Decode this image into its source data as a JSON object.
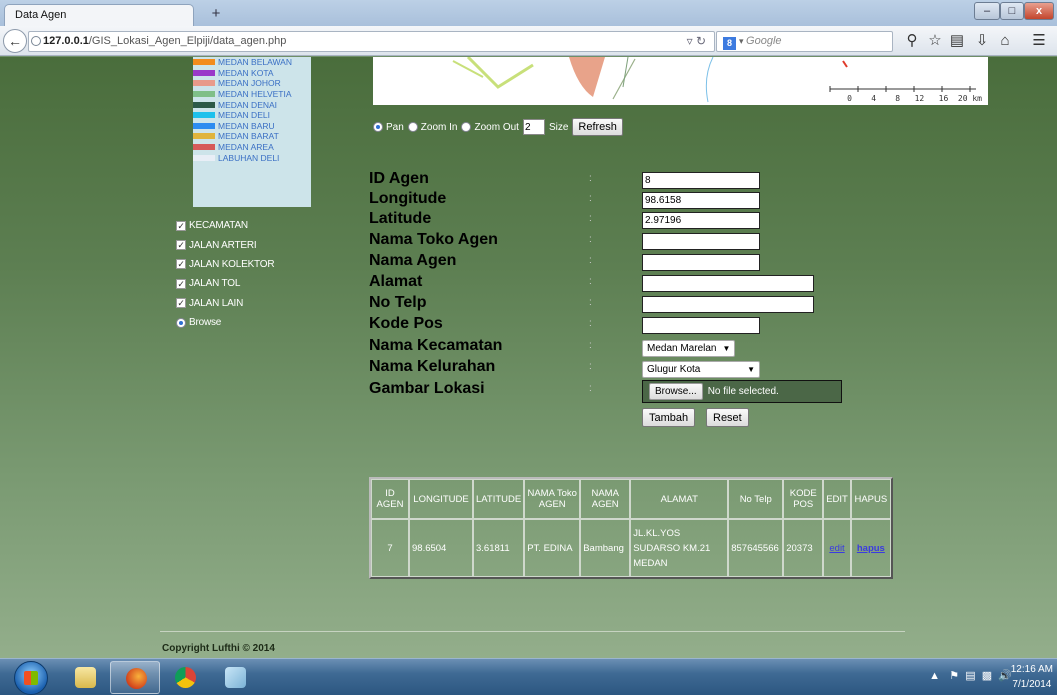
{
  "browser": {
    "tab_title": "Data Agen",
    "new_tab": "+",
    "url_host": "127.0.0.1",
    "url_path": "/GIS_Lokasi_Agen_Elpiji/data_agen.php",
    "search_placeholder": "Google",
    "search_engine_icon": "8",
    "win_min": "–",
    "win_max": "□",
    "win_close": "x"
  },
  "legend": {
    "items": [
      {
        "label": "MEDAN BELAWAN",
        "color": "#f28c1d"
      },
      {
        "label": "MEDAN KOTA",
        "color": "#9a39c9"
      },
      {
        "label": "MEDAN JOHOR",
        "color": "#e89a8a"
      },
      {
        "label": "MEDAN HELVETIA",
        "color": "#7fbf88"
      },
      {
        "label": "MEDAN DENAI",
        "color": "#2c5a48"
      },
      {
        "label": "MEDAN DELI",
        "color": "#1ec1ec"
      },
      {
        "label": "MEDAN BARU",
        "color": "#2d8cf0"
      },
      {
        "label": "MEDAN BARAT",
        "color": "#e0b43c"
      },
      {
        "label": "MEDAN AREA",
        "color": "#d65a5a"
      },
      {
        "label": "LABUHAN DELI",
        "color": "#e8eef6"
      }
    ]
  },
  "layers": {
    "items": [
      {
        "label": "KECAMATAN",
        "type": "checkbox"
      },
      {
        "label": "JALAN ARTERI",
        "type": "checkbox"
      },
      {
        "label": "JALAN KOLEKTOR",
        "type": "checkbox"
      },
      {
        "label": "JALAN TOL",
        "type": "checkbox"
      },
      {
        "label": "JALAN LAIN",
        "type": "checkbox"
      },
      {
        "label": "Browse",
        "type": "radio"
      }
    ]
  },
  "map": {
    "scale_ticks": "0    4    8   12   16  20 km"
  },
  "map_tools": {
    "pan": "Pan",
    "zoom_in": "Zoom In",
    "zoom_out": "Zoom Out",
    "zoom_value": "2",
    "size": "Size",
    "refresh": "Refresh"
  },
  "form": {
    "colon": ":",
    "id_agen": {
      "label": "ID Agen",
      "value": "8"
    },
    "longitude": {
      "label": "Longitude",
      "value": "98.6158"
    },
    "latitude": {
      "label": "Latitude",
      "value": "2.97196"
    },
    "nama_toko": {
      "label": "Nama Toko Agen",
      "value": ""
    },
    "nama_agen": {
      "label": "Nama Agen",
      "value": ""
    },
    "alamat": {
      "label": "Alamat",
      "value": ""
    },
    "no_telp": {
      "label": "No Telp",
      "value": ""
    },
    "kode_pos": {
      "label": "Kode Pos",
      "value": ""
    },
    "kecamatan": {
      "label": "Nama Kecamatan",
      "value": "Medan Marelan"
    },
    "kelurahan": {
      "label": "Nama Kelurahan",
      "value": "Glugur Kota"
    },
    "gambar": {
      "label": "Gambar Lokasi",
      "browse": "Browse...",
      "status": "No file selected."
    },
    "tambah": "Tambah",
    "reset": "Reset"
  },
  "table": {
    "headers": [
      "ID AGEN",
      "LONGITUDE",
      "LATITUDE",
      "NAMA Toko AGEN",
      "NAMA AGEN",
      "ALAMAT",
      "No Telp",
      "KODE POS",
      "EDIT",
      "HAPUS"
    ],
    "rows": [
      {
        "id": "7",
        "longitude": "98.6504",
        "latitude": "3.61811",
        "toko": "PT. EDINA",
        "agen": "Bambang",
        "alamat": "JL.KL.YOS SUDARSO KM.21 MEDAN",
        "telp": "857645566",
        "kode_pos": "20373",
        "edit": "edit",
        "hapus": "hapus"
      }
    ]
  },
  "footer": {
    "copyright": "Copyright Lufthi © 2014"
  },
  "taskbar": {
    "time": "12:16 AM",
    "date": "7/1/2014"
  }
}
